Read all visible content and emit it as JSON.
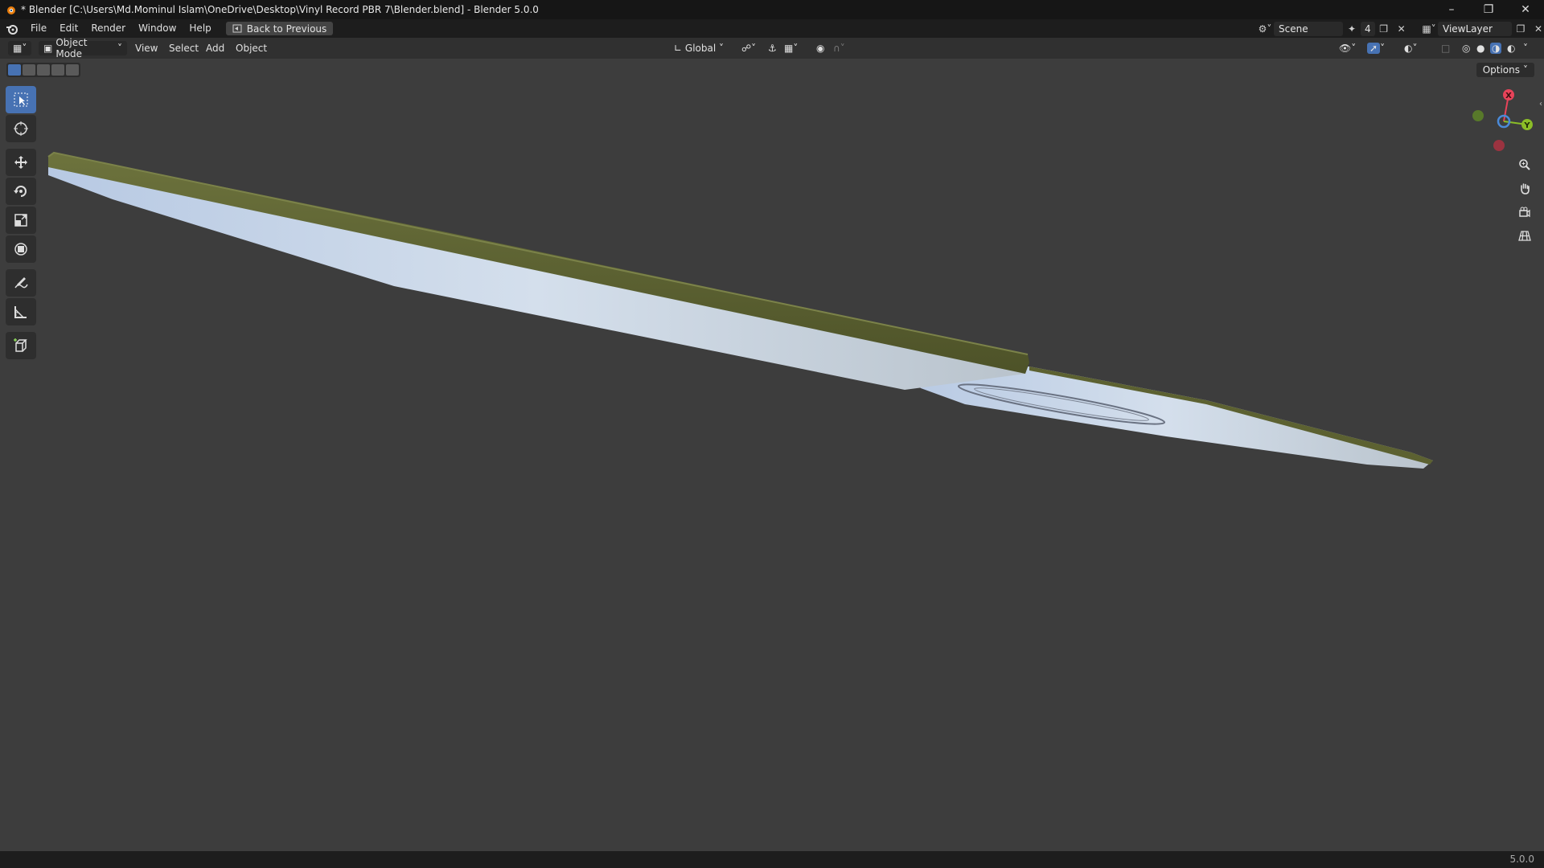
{
  "window": {
    "title": "* Blender [C:\\Users\\Md.Mominul Islam\\OneDrive\\Desktop\\Vinyl Record PBR 7\\Blender.blend] - Blender 5.0.0",
    "minimize_icon": "minimize-icon",
    "maximize_icon": "restore-icon",
    "close_icon": "close-icon"
  },
  "menubar": {
    "items": [
      "File",
      "Edit",
      "Render",
      "Window",
      "Help"
    ],
    "back_button": "Back to Previous",
    "scene_name": "Scene",
    "scene_users": "4",
    "view_layer": "ViewLayer"
  },
  "viewport_header": {
    "mode": "Object Mode",
    "menus": [
      "View",
      "Select",
      "Add",
      "Object"
    ],
    "transform_orientation": "Global"
  },
  "viewport": {
    "options_label": "Options",
    "gizmo_axes": [
      "X",
      "Y"
    ],
    "axis_colors": {
      "x": "#e8435a",
      "y": "#8bbd27",
      "z": "#4a8ad9"
    },
    "object_colors": {
      "rim": "#5c6131",
      "surface": "#cfdcea"
    }
  },
  "toolbar": {
    "tools": [
      "select-box-icon",
      "cursor-icon",
      "move-icon",
      "rotate-icon",
      "scale-icon",
      "transform-icon",
      "annotate-icon",
      "measure-icon",
      "add-cube-icon"
    ]
  },
  "statusbar": {
    "version": "5.0.0"
  }
}
